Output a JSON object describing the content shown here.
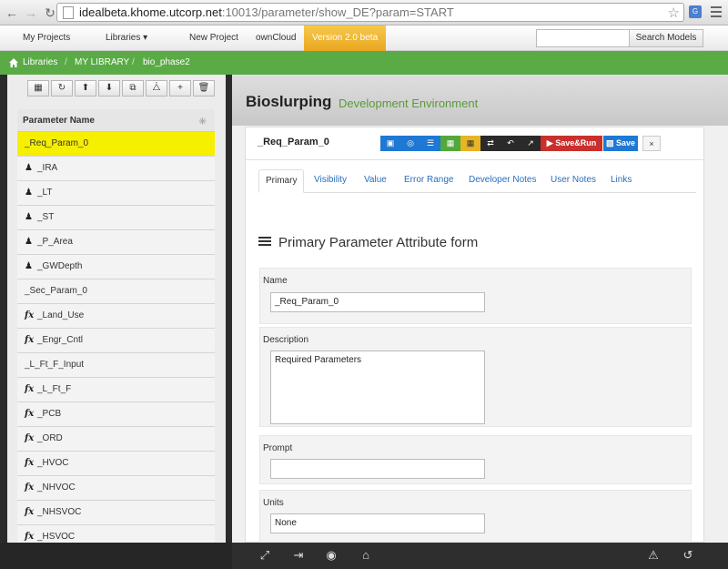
{
  "browser": {
    "url_host": "idealbeta.khome.utcorp.net",
    "url_path": ":10013/parameter/show_DE?param=START"
  },
  "navbar": {
    "my_projects": "My Projects",
    "libraries": "Libraries",
    "new_project": "New Project",
    "owncloud": "ownCloud",
    "version": "Version 2.0 beta",
    "search_button": "Search Models",
    "search_value": ""
  },
  "breadcrumb": {
    "items": [
      "Libraries",
      "MY LIBRARY",
      "bio_phase2"
    ],
    "separator": "/"
  },
  "sidebar": {
    "header": "Parameter Name",
    "items": [
      {
        "label": "_Req_Param_0",
        "icon": "asterisk-icon",
        "selected": true
      },
      {
        "label": "_IRA",
        "icon": "user-icon"
      },
      {
        "label": "_LT",
        "icon": "user-icon"
      },
      {
        "label": "_ST",
        "icon": "user-icon"
      },
      {
        "label": "_P_Area",
        "icon": "user-icon"
      },
      {
        "label": "_GWDepth",
        "icon": "user-icon"
      },
      {
        "label": "_Sec_Param_0",
        "icon": "asterisk-icon"
      },
      {
        "label": "_Land_Use",
        "icon": "function-icon"
      },
      {
        "label": "_Engr_Cntl",
        "icon": "function-icon"
      },
      {
        "label": "_L_Ft_F_Input",
        "icon": "asterisk-icon"
      },
      {
        "label": "_L_Ft_F",
        "icon": "function-icon"
      },
      {
        "label": "_PCB",
        "icon": "function-icon"
      },
      {
        "label": "_ORD",
        "icon": "function-icon"
      },
      {
        "label": "_HVOC",
        "icon": "function-icon"
      },
      {
        "label": "_NHVOC",
        "icon": "function-icon"
      },
      {
        "label": "_NHSVOC",
        "icon": "function-icon"
      },
      {
        "label": "_HSVOC",
        "icon": "function-icon"
      }
    ]
  },
  "main": {
    "title": "Bioslurping",
    "subtitle": "Development Environment",
    "param_title": "_Req_Param_0",
    "save_run": "Save&Run",
    "save": "Save",
    "close": "×",
    "tabs": [
      "Primary",
      "Visibility",
      "Value",
      "Error Range",
      "Developer Notes",
      "User Notes",
      "Links"
    ],
    "form_title": "Primary Parameter Attribute form",
    "fields": {
      "name_label": "Name",
      "name_value": "_Req_Param_0",
      "description_label": "Description",
      "description_value": "Required Parameters",
      "prompt_label": "Prompt",
      "prompt_value": "",
      "units_label": "Units",
      "units_value": "None"
    }
  },
  "colors": {
    "accent_green": "#5aab45",
    "selected_row": "#f7ef00",
    "version_badge": "#e9a71f",
    "primary_blue": "#1e78d4",
    "danger_red": "#c9302c"
  }
}
